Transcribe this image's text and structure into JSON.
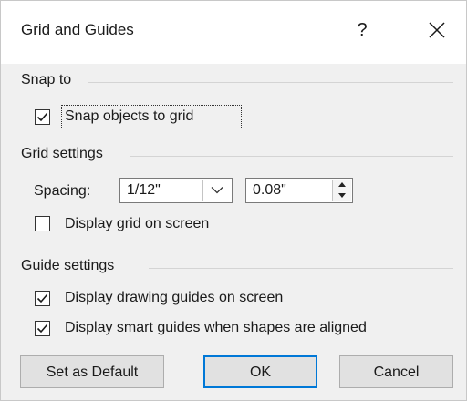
{
  "window": {
    "title": "Grid and Guides",
    "help_glyph": "?",
    "close_icon": "close-icon"
  },
  "snap_to": {
    "heading": "Snap to",
    "snap_objects": {
      "label": "Snap objects to grid",
      "checked": true
    }
  },
  "grid_settings": {
    "heading": "Grid settings",
    "spacing_label": "Spacing:",
    "spacing_value": "1/12\"",
    "spacing_custom": "0.08\"",
    "display_grid": {
      "label": "Display grid on screen",
      "checked": false
    }
  },
  "guide_settings": {
    "heading": "Guide settings",
    "display_drawing_guides": {
      "label": "Display drawing guides on screen",
      "checked": true
    },
    "display_smart_guides": {
      "label": "Display smart guides when shapes are aligned",
      "checked": true
    }
  },
  "buttons": {
    "set_default": "Set as Default",
    "ok": "OK",
    "cancel": "Cancel"
  },
  "colors": {
    "dialog_bg": "#f0f0f0",
    "primary_border": "#0078d7"
  }
}
